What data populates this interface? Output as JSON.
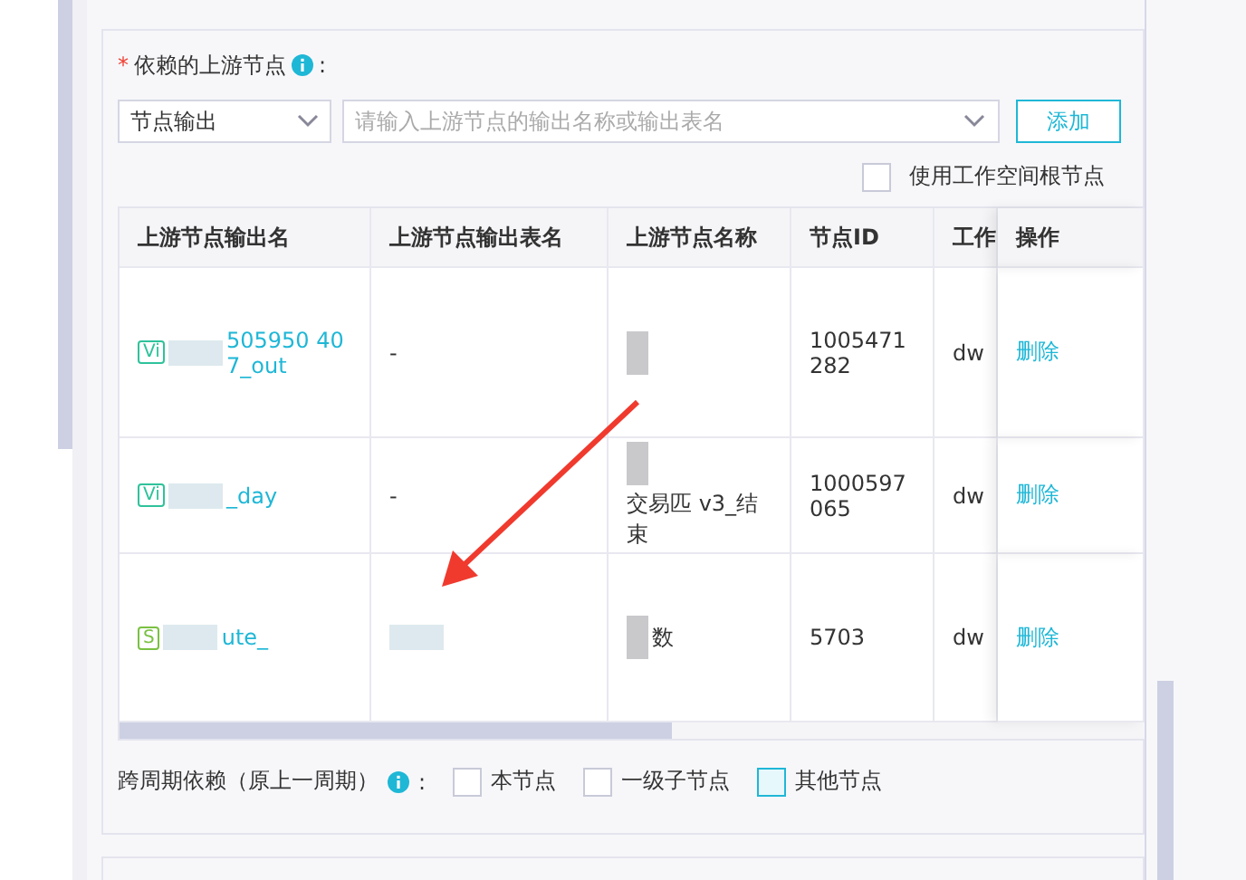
{
  "upstream": {
    "required_mark": "*",
    "label": "依赖的上游节点",
    "colon": ":",
    "select": {
      "value": "节点输出"
    },
    "search": {
      "placeholder": "请输入上游节点的输出名称或输出表名"
    },
    "add_button": "添加",
    "root_checkbox": {
      "label": "使用工作空间根节点",
      "checked": false
    }
  },
  "table": {
    "columns": [
      "上游节点输出名",
      "上游节点输出表名",
      "上游节点名称",
      "节点ID",
      "工作",
      "操作"
    ],
    "rows": [
      {
        "tag": "Vi",
        "color": "#2fc29b",
        "output_name": "505950 407_out",
        "table_name": "-",
        "node_name": "",
        "node_id": "1005471282",
        "workspace": "dw",
        "action": "删除"
      },
      {
        "tag": "Vi",
        "color": "#2fc29b",
        "output_name": "_day",
        "table_name": "-",
        "node_name": "交易匹 v3_结束",
        "node_id": "1000597065",
        "workspace": "dw",
        "action": "删除"
      },
      {
        "tag": "S",
        "color": "#7ac142",
        "output_name": "ute_",
        "table_name": "",
        "node_name": "数",
        "node_id": "5703",
        "workspace": "dw",
        "action": "删除"
      }
    ]
  },
  "cross_period": {
    "label": "跨周期依赖（原上一周期）",
    "colon": ":",
    "options": [
      {
        "label": "本节点",
        "checked": false,
        "focused": false
      },
      {
        "label": "一级子节点",
        "checked": false,
        "focused": false
      },
      {
        "label": "其他节点",
        "checked": false,
        "focused": true
      }
    ]
  }
}
